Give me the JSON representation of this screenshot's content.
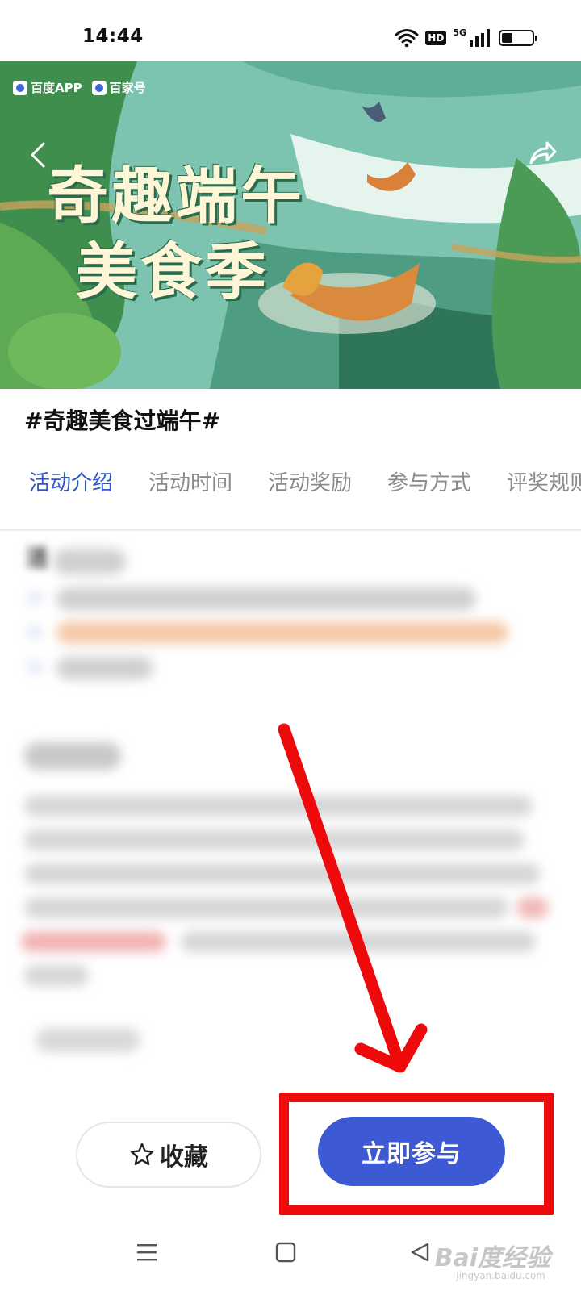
{
  "status_bar": {
    "time": "14:44",
    "hd_badge": "HD",
    "network": "5G",
    "icons": [
      "wifi-icon",
      "signal-icon",
      "battery-icon"
    ],
    "battery_level": 0.35
  },
  "banner": {
    "brands": [
      "百度APP",
      "百家号"
    ],
    "title_line1": "奇趣端午",
    "title_line2": "美食季",
    "back_icon": "chevron-left-icon",
    "share_icon": "share-icon"
  },
  "topic": {
    "title": "#奇趣美食过端午#"
  },
  "tabs": [
    {
      "label": "活动介绍",
      "active": true
    },
    {
      "label": "活动时间",
      "active": false
    },
    {
      "label": "活动奖励",
      "active": false
    },
    {
      "label": "参与方式",
      "active": false
    },
    {
      "label": "评奖规则",
      "active": false
    }
  ],
  "content": {
    "section_heading": "活"
  },
  "actions": {
    "favorite_label": "收藏",
    "favorite_icon": "star-outline-icon",
    "join_label": "立即参与"
  },
  "nav_bar": {
    "icons": [
      "menu-icon",
      "home-square-icon",
      "back-triangle-icon"
    ]
  },
  "watermark": {
    "text": "Bai度经验",
    "sub": "jingyan.baidu.com"
  },
  "colors": {
    "accent": "#3d59d4",
    "tab_active": "#2f56c6",
    "annotation_red": "#ee0a0a"
  }
}
